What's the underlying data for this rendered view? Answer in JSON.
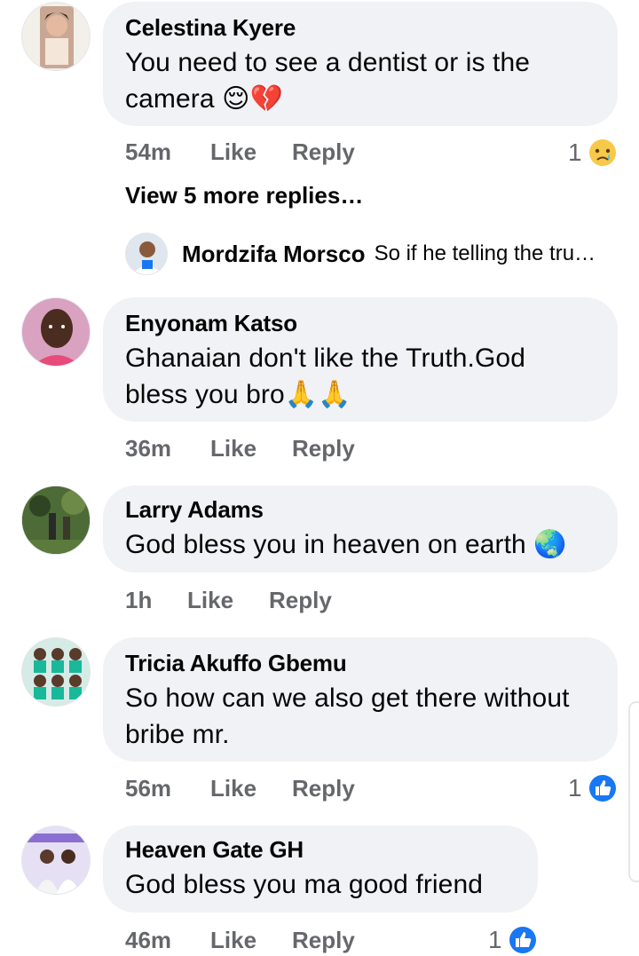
{
  "comments": [
    {
      "author": "Celestina Kyere",
      "text": "You need to see a dentist or is the camera",
      "emojis": "😌💔",
      "time": "54m",
      "like_label": "Like",
      "reply_label": "Reply",
      "reaction_count": "1",
      "reaction_icon": "sad-reaction-icon",
      "view_more": "View 5 more replies…",
      "reply_preview": {
        "author": "Mordzifa Morsco",
        "text": "So if he telling the tru…"
      }
    },
    {
      "author": "Enyonam Katso",
      "text_line1": "Ghanaian don't like the Truth.God",
      "text_line2": "bless you bro",
      "emojis": "🙏🙏",
      "time": "36m",
      "like_label": "Like",
      "reply_label": "Reply"
    },
    {
      "author": "Larry Adams",
      "text": "God bless you in heaven on earth",
      "emojis": "🌏",
      "time": "1h",
      "like_label": "Like",
      "reply_label": "Reply"
    },
    {
      "author": "Tricia Akuffo Gbemu",
      "text_line1": "So how can we also get there without",
      "text_line2": "bribe mr.",
      "time": "56m",
      "like_label": "Like",
      "reply_label": "Reply",
      "reaction_count": "1",
      "reaction_icon": "like-reaction-icon"
    },
    {
      "author": "Heaven Gate GH",
      "text": "God bless you ma good friend",
      "time": "46m",
      "like_label": "Like",
      "reply_label": "Reply",
      "reaction_count": "1",
      "reaction_icon": "like-reaction-icon"
    }
  ],
  "colors": {
    "bubble": "#f0f2f5",
    "meta_text": "#65676b",
    "like_blue": "#1877f2"
  }
}
